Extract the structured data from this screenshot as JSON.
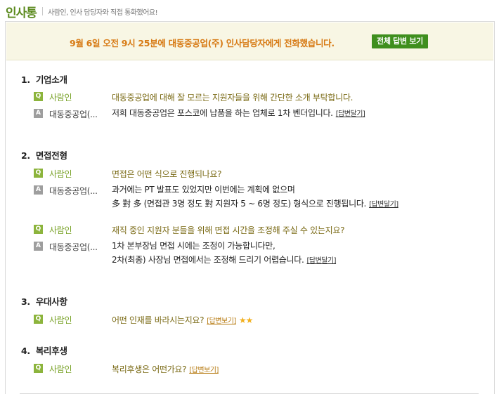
{
  "header": {
    "brand": "인사통",
    "tagline": "사람인, 인사 담당자와 직접 통화했어요!"
  },
  "notice": {
    "text": "9월 6일 오전 9시 25분에 대동중공업(주) 인사담당자에게 전화했습니다.",
    "button_label": "전체 답변 보기"
  },
  "sections": [
    {
      "num": "1.",
      "title": "기업소개",
      "items": [
        {
          "q_who": "사람인",
          "q_text": "대동중공업에 대해 잘 모르는 지원자들을 위해 간단한 소개 부탁합니다.",
          "a_who": "대동중공업(...",
          "a_lines": [
            "저희 대동중공업은 포스코에 납품을 하는 업체로 1차 벤더입니다."
          ],
          "a_link": "[답변달기]"
        }
      ]
    },
    {
      "num": "2.",
      "title": "면접전형",
      "items": [
        {
          "q_who": "사람인",
          "q_text": "면접은 어떤 식으로 진행되나요?",
          "a_who": "대동중공업(...",
          "a_lines": [
            "과거에는 PT 발표도 있었지만 이번에는 계획에 없으며",
            "多 對 多 (면접관 3명 정도 對 지원자 5 ~ 6명 정도) 형식으로 진행됩니다."
          ],
          "a_link": "[답변달기]"
        },
        {
          "q_who": "사람인",
          "q_text": "재직 중인 지원자 분들을 위해 면접 시간을 조정해 주실 수 있는지요?",
          "a_who": "대동중공업(...",
          "a_lines": [
            "1차 본부장님 면접 시에는 조정이 가능합니다만,",
            "2차(최종) 사장님 면접에서는 조정해 드리기 어렵습니다."
          ],
          "a_link": "[답변달기]"
        }
      ]
    },
    {
      "num": "3.",
      "title": "우대사항",
      "items": [
        {
          "q_who": "사람인",
          "q_text": "어떤 인재를 바라시는지요?",
          "q_link": "[답변보기]",
          "stars": "★★"
        }
      ]
    },
    {
      "num": "4.",
      "title": "복리후생",
      "items": [
        {
          "q_who": "사람인",
          "q_text": "복리후생은 어떤가요?",
          "q_link": "[답변보기]"
        }
      ]
    }
  ],
  "badges": {
    "q": "Q",
    "a": "A"
  },
  "icons": {
    "star": "star-icon"
  },
  "colors": {
    "brand": "#5b8a1e",
    "notice_text": "#d77a14",
    "button": "#3f8f1e",
    "q_badge": "#8cb43c",
    "a_badge": "#9e9e9e"
  }
}
